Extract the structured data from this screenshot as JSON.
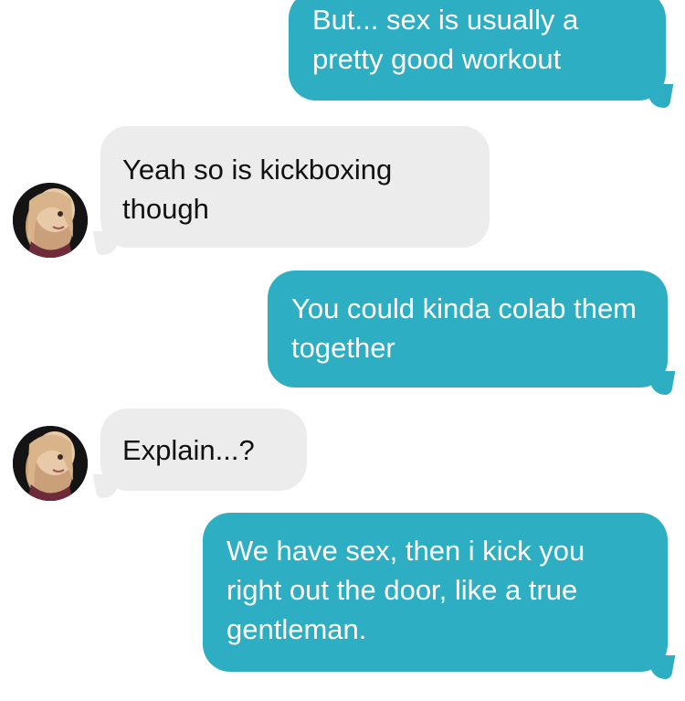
{
  "conversation": {
    "messages": [
      {
        "side": "sent",
        "text": "But... sex is usually a pretty good workout"
      },
      {
        "side": "received",
        "text": "Yeah so is kickboxing though"
      },
      {
        "side": "sent",
        "text": "You could kinda colab them together"
      },
      {
        "side": "received",
        "text": "Explain...?"
      },
      {
        "side": "sent",
        "text": "We have sex, then i kick you right out the door, like a true gentleman."
      }
    ]
  },
  "colors": {
    "sent_bubble": "#2eaec2",
    "received_bubble": "#ececec",
    "sent_text": "#ffffff",
    "received_text": "#111111"
  },
  "icons": {
    "contact_avatar": "contact-avatar-photo"
  }
}
